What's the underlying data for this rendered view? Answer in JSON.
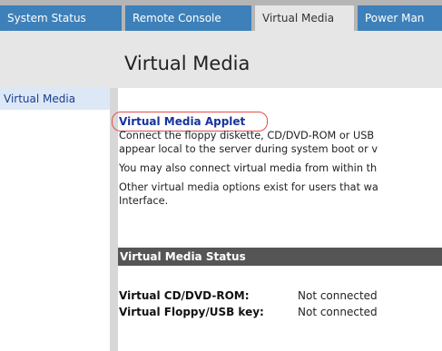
{
  "tabs": [
    {
      "label": "System Status"
    },
    {
      "label": "Remote Console"
    },
    {
      "label": "Virtual Media"
    },
    {
      "label": "Power Man"
    }
  ],
  "page": {
    "title": "Virtual Media"
  },
  "sidebar": {
    "items": [
      {
        "label": "Virtual Media"
      }
    ]
  },
  "main": {
    "applet_link": "Virtual Media Applet",
    "description_lines": [
      "Connect the floppy diskette, CD/DVD-ROM or USB",
      "appear local to the server during system boot or v",
      "You may also connect virtual media from within th",
      "Other virtual media options exist for users that wa",
      "Interface."
    ],
    "status_section": {
      "header": "Virtual Media Status",
      "rows": [
        {
          "label": "Virtual CD/DVD-ROM:",
          "value": "Not connected"
        },
        {
          "label": "Virtual Floppy/USB key:",
          "value": "Not connected"
        }
      ]
    }
  },
  "colors": {
    "tab_bg": "#3e80b9",
    "active_tab_bg": "#e6e6e6",
    "link": "#17329a",
    "highlight_ring": "#e24d4d",
    "status_header_bg": "#555555"
  }
}
